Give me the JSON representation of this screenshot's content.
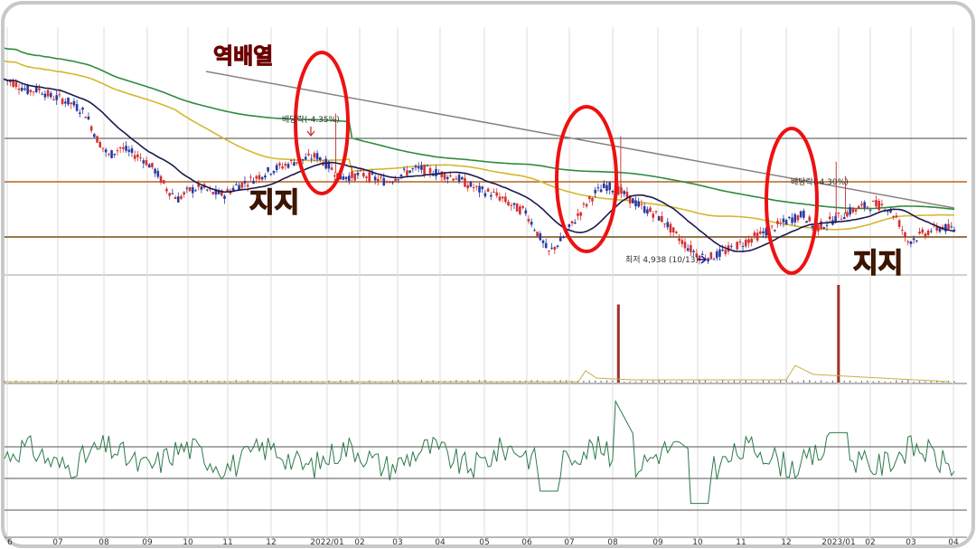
{
  "chart_data": [
    {
      "type": "candlestick",
      "panel": "price",
      "x_ticks": [
        "6",
        "07",
        "08",
        "09",
        "10",
        "11",
        "12",
        "2022/01",
        "02",
        "03",
        "04",
        "05",
        "06",
        "07",
        "08",
        "09",
        "10",
        "11",
        "12",
        "2023/01",
        "02",
        "03",
        "04"
      ],
      "moving_averages": [
        {
          "color": "#1a1a50",
          "period_hint": "short"
        },
        {
          "color": "#d4b830",
          "period_hint": "mid"
        },
        {
          "color": "#2e8b3e",
          "period_hint": "long"
        },
        {
          "color": "#8c7f7f",
          "period_hint": "trendline"
        }
      ],
      "horizontal_lines": [
        {
          "color": "#444444",
          "role": "resistance"
        },
        {
          "color": "#b5651d",
          "role": "support-upper"
        },
        {
          "color": "#7a4a10",
          "role": "support-lower"
        }
      ],
      "annotations": {
        "inverse": "역배열",
        "support_left": "지지",
        "support_right": "지지",
        "dividend_left": "배당락(-4.35%)",
        "dividend_right": "배당락(-4.30%)",
        "low_label": "최저 4,938 (10/13)"
      },
      "low_value": 4938,
      "low_date": "10/13",
      "highlight_color": "#ee1111",
      "price_path": [
        [
          0,
          6200
        ],
        [
          1,
          6170
        ],
        [
          2,
          6120
        ],
        [
          3,
          6130
        ],
        [
          4,
          6080
        ],
        [
          5,
          6060
        ],
        [
          6,
          6020
        ],
        [
          7,
          5960
        ],
        [
          8,
          5780
        ],
        [
          9,
          5660
        ],
        [
          10,
          5720
        ],
        [
          11,
          5680
        ],
        [
          12,
          5640
        ],
        [
          13,
          5560
        ],
        [
          14,
          5430
        ],
        [
          15,
          5360
        ],
        [
          16,
          5420
        ],
        [
          17,
          5440
        ],
        [
          18,
          5400
        ],
        [
          19,
          5390
        ],
        [
          20,
          5450
        ],
        [
          21,
          5480
        ],
        [
          22,
          5520
        ],
        [
          23,
          5560
        ],
        [
          24,
          5590
        ],
        [
          25,
          5620
        ],
        [
          26,
          5640
        ],
        [
          27,
          5660
        ],
        [
          28,
          5590
        ],
        [
          29,
          5510
        ],
        [
          30,
          5520
        ],
        [
          31,
          5530
        ],
        [
          32,
          5500
        ],
        [
          33,
          5480
        ],
        [
          34,
          5520
        ],
        [
          35,
          5560
        ],
        [
          36,
          5570
        ],
        [
          37,
          5550
        ],
        [
          38,
          5530
        ],
        [
          39,
          5510
        ],
        [
          40,
          5460
        ],
        [
          41,
          5420
        ],
        [
          42,
          5400
        ],
        [
          43,
          5360
        ],
        [
          44,
          5300
        ],
        [
          45,
          5270
        ],
        [
          46,
          5120
        ],
        [
          47,
          4980
        ],
        [
          48,
          5060
        ],
        [
          49,
          5180
        ],
        [
          50,
          5300
        ],
        [
          51,
          5400
        ],
        [
          52,
          5450
        ],
        [
          53,
          5420
        ],
        [
          54,
          5360
        ],
        [
          55,
          5300
        ],
        [
          56,
          5260
        ],
        [
          57,
          5200
        ],
        [
          58,
          5100
        ],
        [
          59,
          5020
        ],
        [
          60,
          4960
        ],
        [
          61,
          4950
        ],
        [
          62,
          4980
        ],
        [
          63,
          5020
        ],
        [
          64,
          5060
        ],
        [
          65,
          5100
        ],
        [
          66,
          5140
        ],
        [
          67,
          5180
        ],
        [
          68,
          5220
        ],
        [
          69,
          5250
        ],
        [
          70,
          5150
        ],
        [
          71,
          5190
        ],
        [
          72,
          5230
        ],
        [
          73,
          5270
        ],
        [
          74,
          5300
        ],
        [
          75,
          5320
        ],
        [
          76,
          5310
        ],
        [
          77,
          5230
        ],
        [
          78,
          5060
        ],
        [
          79,
          5100
        ],
        [
          80,
          5140
        ],
        [
          81,
          5160
        ],
        [
          82,
          5140
        ]
      ]
    },
    {
      "type": "bar",
      "panel": "volume",
      "spikes": [
        {
          "at": 53,
          "value": 80,
          "color": "#a0302a"
        },
        {
          "at": 72,
          "value": 100,
          "color": "#a0302a"
        }
      ]
    },
    {
      "type": "line",
      "panel": "oscillator",
      "color": "#2e7a4a",
      "levels": [
        75,
        50,
        25
      ]
    }
  ]
}
